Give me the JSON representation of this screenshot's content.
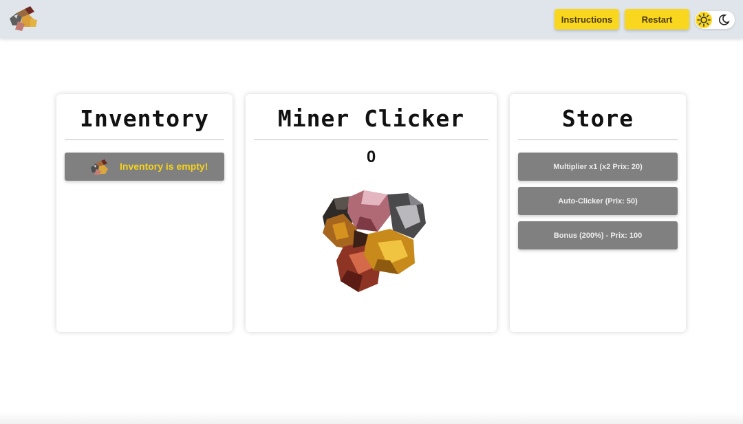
{
  "header": {
    "logo_icon": "ore-pile-logo",
    "instructions_label": "Instructions",
    "restart_label": "Restart",
    "theme_toggle": {
      "light_icon": "sun-icon",
      "dark_icon": "moon-icon",
      "selected": "light"
    }
  },
  "inventory": {
    "title": "Inventory",
    "empty_message": "Inventory is empty!",
    "empty_icon": "ore-pile-icon"
  },
  "game": {
    "title": "Miner Clicker",
    "score": "0",
    "ore_icon": "ore-cluster"
  },
  "store": {
    "title": "Store",
    "items": [
      {
        "label": "Multiplier x1 (x2 Prix: 20)"
      },
      {
        "label": "Auto-Clicker (Prix: 50)"
      },
      {
        "label": "Bonus (200%) - Prix: 100"
      }
    ]
  },
  "colors": {
    "accent": "#fad71f",
    "header_bg": "#dfe5ea",
    "item_bg": "#808080",
    "empty_text": "#f5d31c"
  }
}
